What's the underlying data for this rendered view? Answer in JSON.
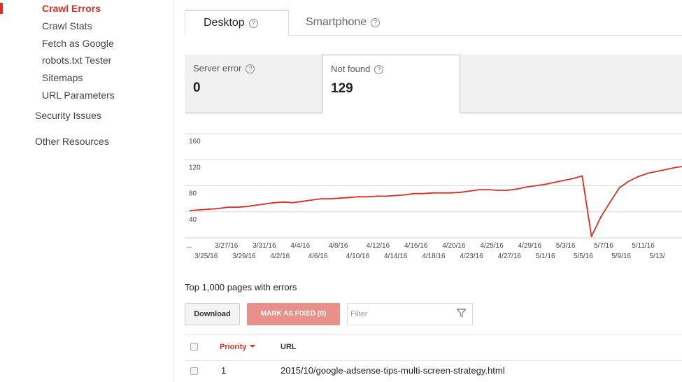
{
  "sidebar": {
    "sub_items": [
      {
        "label": "Crawl Errors",
        "active": true
      },
      {
        "label": "Crawl Stats",
        "active": false
      },
      {
        "label": "Fetch as Google",
        "active": false
      },
      {
        "label": "robots.txt Tester",
        "active": false
      },
      {
        "label": "Sitemaps",
        "active": false
      },
      {
        "label": "URL Parameters",
        "active": false
      }
    ],
    "security_issues": "Security Issues",
    "other_resources": "Other Resources"
  },
  "device_tabs": {
    "desktop": "Desktop",
    "smartphone": "Smartphone",
    "help_glyph": "?"
  },
  "error_tabs": {
    "server_error": {
      "label": "Server error",
      "count": "0"
    },
    "not_found": {
      "label": "Not found",
      "count": "129"
    }
  },
  "chart_data": {
    "type": "line",
    "title": "",
    "xlabel": "",
    "ylabel": "",
    "ylim": [
      0,
      160
    ],
    "y_ticks": [
      "160",
      "120",
      "80",
      "40"
    ],
    "grid": true,
    "color": "#dd2c23",
    "x_leading_label": "...",
    "x_upper_labels": [
      "3/27/16",
      "3/31/16",
      "4/4/16",
      "4/8/16",
      "4/12/16",
      "4/16/16",
      "4/20/16",
      "4/25/16",
      "4/29/16",
      "5/3/16",
      "5/7/16",
      "5/11/16"
    ],
    "x_lower_labels": [
      "3/25/16",
      "3/29/16",
      "4/2/16",
      "4/6/16",
      "4/10/16",
      "4/14/16",
      "4/18/16",
      "4/23/16",
      "4/27/16",
      "5/1/16",
      "5/5/16",
      "5/9/16",
      "5/13/"
    ],
    "series": [
      {
        "values": [
          42,
          43,
          44,
          45,
          47,
          47,
          48,
          50,
          52,
          54,
          55,
          54,
          56,
          58,
          60,
          60,
          61,
          62,
          63,
          63,
          64,
          64,
          65,
          66,
          68,
          68,
          69,
          69,
          69,
          70,
          72,
          74,
          74,
          73,
          73,
          75,
          78,
          80,
          82,
          85,
          88,
          91,
          95,
          2,
          32,
          55,
          77,
          87,
          94,
          99,
          102,
          105,
          108,
          110
        ]
      }
    ]
  },
  "pages": {
    "title": "Top 1,000 pages with errors",
    "download_label": "Download",
    "mark_fixed_label": "MARK AS FIXED (0)",
    "filter_placeholder": "Filter"
  },
  "table": {
    "headers": {
      "priority": "Priority",
      "url": "URL"
    },
    "rows": [
      {
        "priority": "1",
        "url": "2015/10/google-adsense-tips-multi-screen-strategy.html"
      }
    ]
  }
}
